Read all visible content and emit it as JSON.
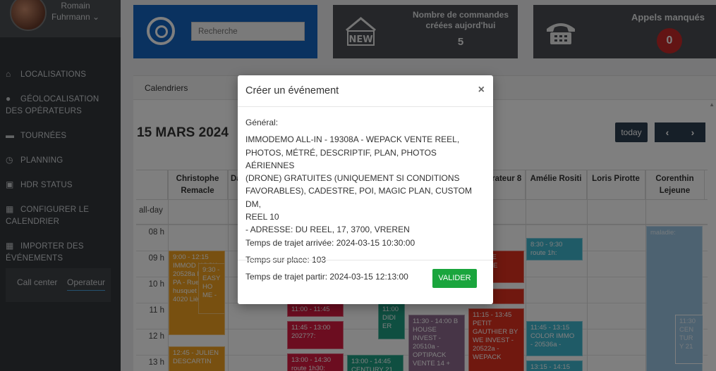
{
  "user": {
    "first_name": "Romain",
    "last_name": "Fuhrmann"
  },
  "sidebar": {
    "items": [
      {
        "label": "LOCALISATIONS",
        "icon": "home-icon"
      },
      {
        "label": "GÉOLOCALISATION DES OPÉRATEURS",
        "icon": "map-pin-icon"
      },
      {
        "label": "TOURNÉES",
        "icon": "car-icon"
      },
      {
        "label": "PLANNING",
        "icon": "clock-icon"
      },
      {
        "label": "HDR STATUS",
        "icon": "image-icon"
      },
      {
        "label": "CONFIGURER LE CALENDRIER",
        "icon": "calendar-icon"
      },
      {
        "label": "IMPORTER DES ÉVÉNEMENTS",
        "icon": "calendar-icon"
      }
    ],
    "roles": {
      "call_center": "Call center",
      "operator": "Operateur"
    }
  },
  "search": {
    "placeholder": "Recherche"
  },
  "stats": {
    "new_orders_title": "Nombre de commandes créées aujord'hui",
    "new_orders_count": "5",
    "missed_calls_title": "Appels manqués",
    "missed_calls_count": "0"
  },
  "calendar": {
    "panel_title": "Calendriers",
    "date": "15 MARS 2024",
    "today_label": "today",
    "prev_label": "‹",
    "next_label": "›",
    "all_day_label": "all-day",
    "columns": [
      "Christophe Remacle",
      "Da",
      "",
      "",
      "",
      "xime rateur 8",
      "Amélie Rositi",
      "Loris Pirotte",
      "Corenthin Lejeune"
    ],
    "hours": [
      "08 h",
      "09 h",
      "10 h",
      "11 h",
      "12 h",
      "13 h"
    ],
    "events": [
      {
        "text": "9:00 - 12:15 IMMOD HOCK 20528a REEL PA - Rue du husquet , 34, 4020 Liège"
      },
      {
        "text": "9:30 - EASY HO ME -"
      },
      {
        "text": "12:45 - JULIEN DESCARTIN"
      },
      {
        "text": "11:00 - 11:45"
      },
      {
        "text": "11:45 - 13:00 2027?7:"
      },
      {
        "text": "13:00 - 14:30 route 1h30:"
      },
      {
        "text": "11:00 DIDI ER"
      },
      {
        "text": "13:00 - 14:45 CENTURY 21"
      },
      {
        "text": "11:30 - 14:00 B HOUSE INVEST - 20510a - OPTIPACK VENTE 14 +"
      },
      {
        "text": "9:30 SE BILIèRE"
      },
      {
        "text": "11:15"
      },
      {
        "text": "11:15 - 13:45 PETIT GAUTHIER BY WE INVEST - 20522a - WEPACK"
      },
      {
        "text": "8:30 - 9:30 route 1h:"
      },
      {
        "text": "11:45 - 13:15 COLOR IMMO - 20536a -"
      },
      {
        "text": "13:15 - 14:15"
      },
      {
        "text": "maladie:"
      },
      {
        "text": "11:30 CEN TUR Y 21"
      }
    ]
  },
  "modal": {
    "title": "Créer un événement",
    "close_label": "×",
    "general_label": "Général:",
    "description_lines": [
      "IMMODEMO ALL-IN - 19308A - WEPACK VENTE REEL,",
      "PHOTOS, MÉTRÉ, DESCRIPTIF, PLAN, PHOTOS AÉRIENNES",
      "(DRONE) GRATUITES (UNIQUEMENT SI CONDITIONS",
      "FAVORABLES), CADESTRE, POI, MAGIC PLAN, CUSTOM DM,",
      "REEL 10",
      "- ADRESSE: DU REEL, 17, 3700, VREREN"
    ],
    "arrival_travel": "Temps de trajet arrivée: 2024-03-15 10:30:00",
    "time_on_site": "Temps sur place: 103",
    "departure_travel": "Temps de trajet partir: 2024-03-15 12:13:00",
    "submit_label": "VALIDER"
  }
}
